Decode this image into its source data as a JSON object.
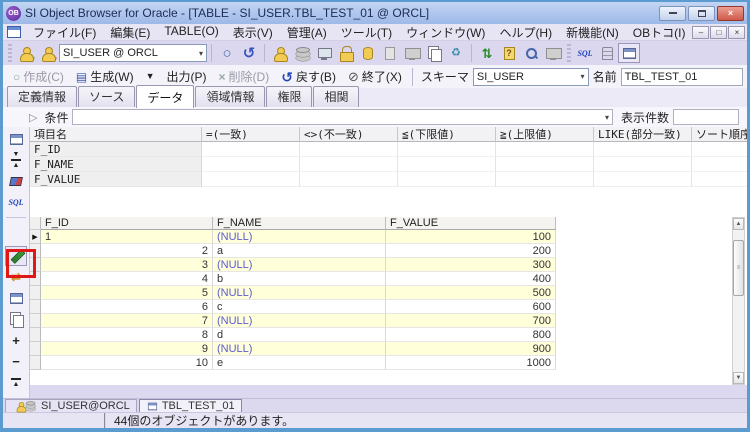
{
  "titlebar": {
    "title": "SI Object Browser for Oracle - [TABLE - SI_USER.TBL_TEST_01 @ ORCL]"
  },
  "menu": {
    "items": [
      "ファイル(F)",
      "編集(E)",
      "TABLE(O)",
      "表示(V)",
      "管理(A)",
      "ツール(T)",
      "ウィンドウ(W)",
      "ヘルプ(H)",
      "新機能(N)",
      "OBトコ(I)"
    ]
  },
  "toolbar": {
    "connection_value": "SI_USER @ ORCL",
    "sql_label": "SQL"
  },
  "actionbar": {
    "create_label": "作成(C)",
    "generate_label": "生成(W)",
    "output_label": "出力(P)",
    "delete_label": "削除(D)",
    "revert_label": "戻す(B)",
    "quit_label": "終了(X)",
    "schema_label": "スキーマ",
    "schema_value": "SI_USER",
    "name_label": "名前",
    "name_value": "TBL_TEST_01"
  },
  "tabs": [
    "定義情報",
    "ソース",
    "データ",
    "領域情報",
    "権限",
    "相関"
  ],
  "active_tab": "データ",
  "condition": {
    "label": "条件",
    "value": "",
    "count_label": "表示件数",
    "count_value": ""
  },
  "filter_grid": {
    "columns": [
      "項目名",
      "=(一致)",
      "<>(不一致)",
      "≦(下限値)",
      "≧(上限値)",
      "LIKE(部分一致)",
      "ソート順序"
    ],
    "rows": [
      "F_ID",
      "F_NAME",
      "F_VALUE"
    ]
  },
  "data_grid": {
    "columns": [
      "F_ID",
      "F_NAME",
      "F_VALUE"
    ],
    "rows": [
      {
        "f_id": "1",
        "f_name": "(NULL)",
        "f_value": "100"
      },
      {
        "f_id": "2",
        "f_name": "a",
        "f_value": "200"
      },
      {
        "f_id": "3",
        "f_name": "(NULL)",
        "f_value": "300"
      },
      {
        "f_id": "4",
        "f_name": "b",
        "f_value": "400"
      },
      {
        "f_id": "5",
        "f_name": "(NULL)",
        "f_value": "500"
      },
      {
        "f_id": "6",
        "f_name": "c",
        "f_value": "600"
      },
      {
        "f_id": "7",
        "f_name": "(NULL)",
        "f_value": "700"
      },
      {
        "f_id": "8",
        "f_name": "d",
        "f_value": "800"
      },
      {
        "f_id": "9",
        "f_name": "(NULL)",
        "f_value": "900"
      },
      {
        "f_id": "10",
        "f_name": "e",
        "f_value": "1000"
      }
    ],
    "current_row_marker": "▶"
  },
  "bottom_tabs": [
    {
      "label": "SI_USER@ORCL"
    },
    {
      "label": "TBL_TEST_01"
    }
  ],
  "statusbar": {
    "message": "44個のオブジェクトがあります。"
  },
  "icons": {
    "app_initials": "OB",
    "minimize": "–",
    "restore": "□",
    "close": "×",
    "dropdown_arrow": "▾",
    "circle": "○",
    "refresh": "↺",
    "generate": "▤",
    "menu_down": "▼",
    "cross": "×",
    "revert": "↺",
    "quit": "⊘",
    "condition_play": "▷",
    "recycle": "♻",
    "refresh_db": "⇅",
    "export_arrows": "⇄",
    "plus": "+",
    "minus": "−",
    "up_small": "▲",
    "scroll_up": "▲",
    "scroll_down": "▼",
    "thumb_grip": "≡",
    "to_top": "↥"
  },
  "colors": {
    "highlight_red": "#e01818",
    "row_yellow": "#ffffd9",
    "null_text": "#5b5bd6",
    "titlebar_blue": "#9db9e8",
    "toolbar_lavender": "#dad7ee"
  }
}
